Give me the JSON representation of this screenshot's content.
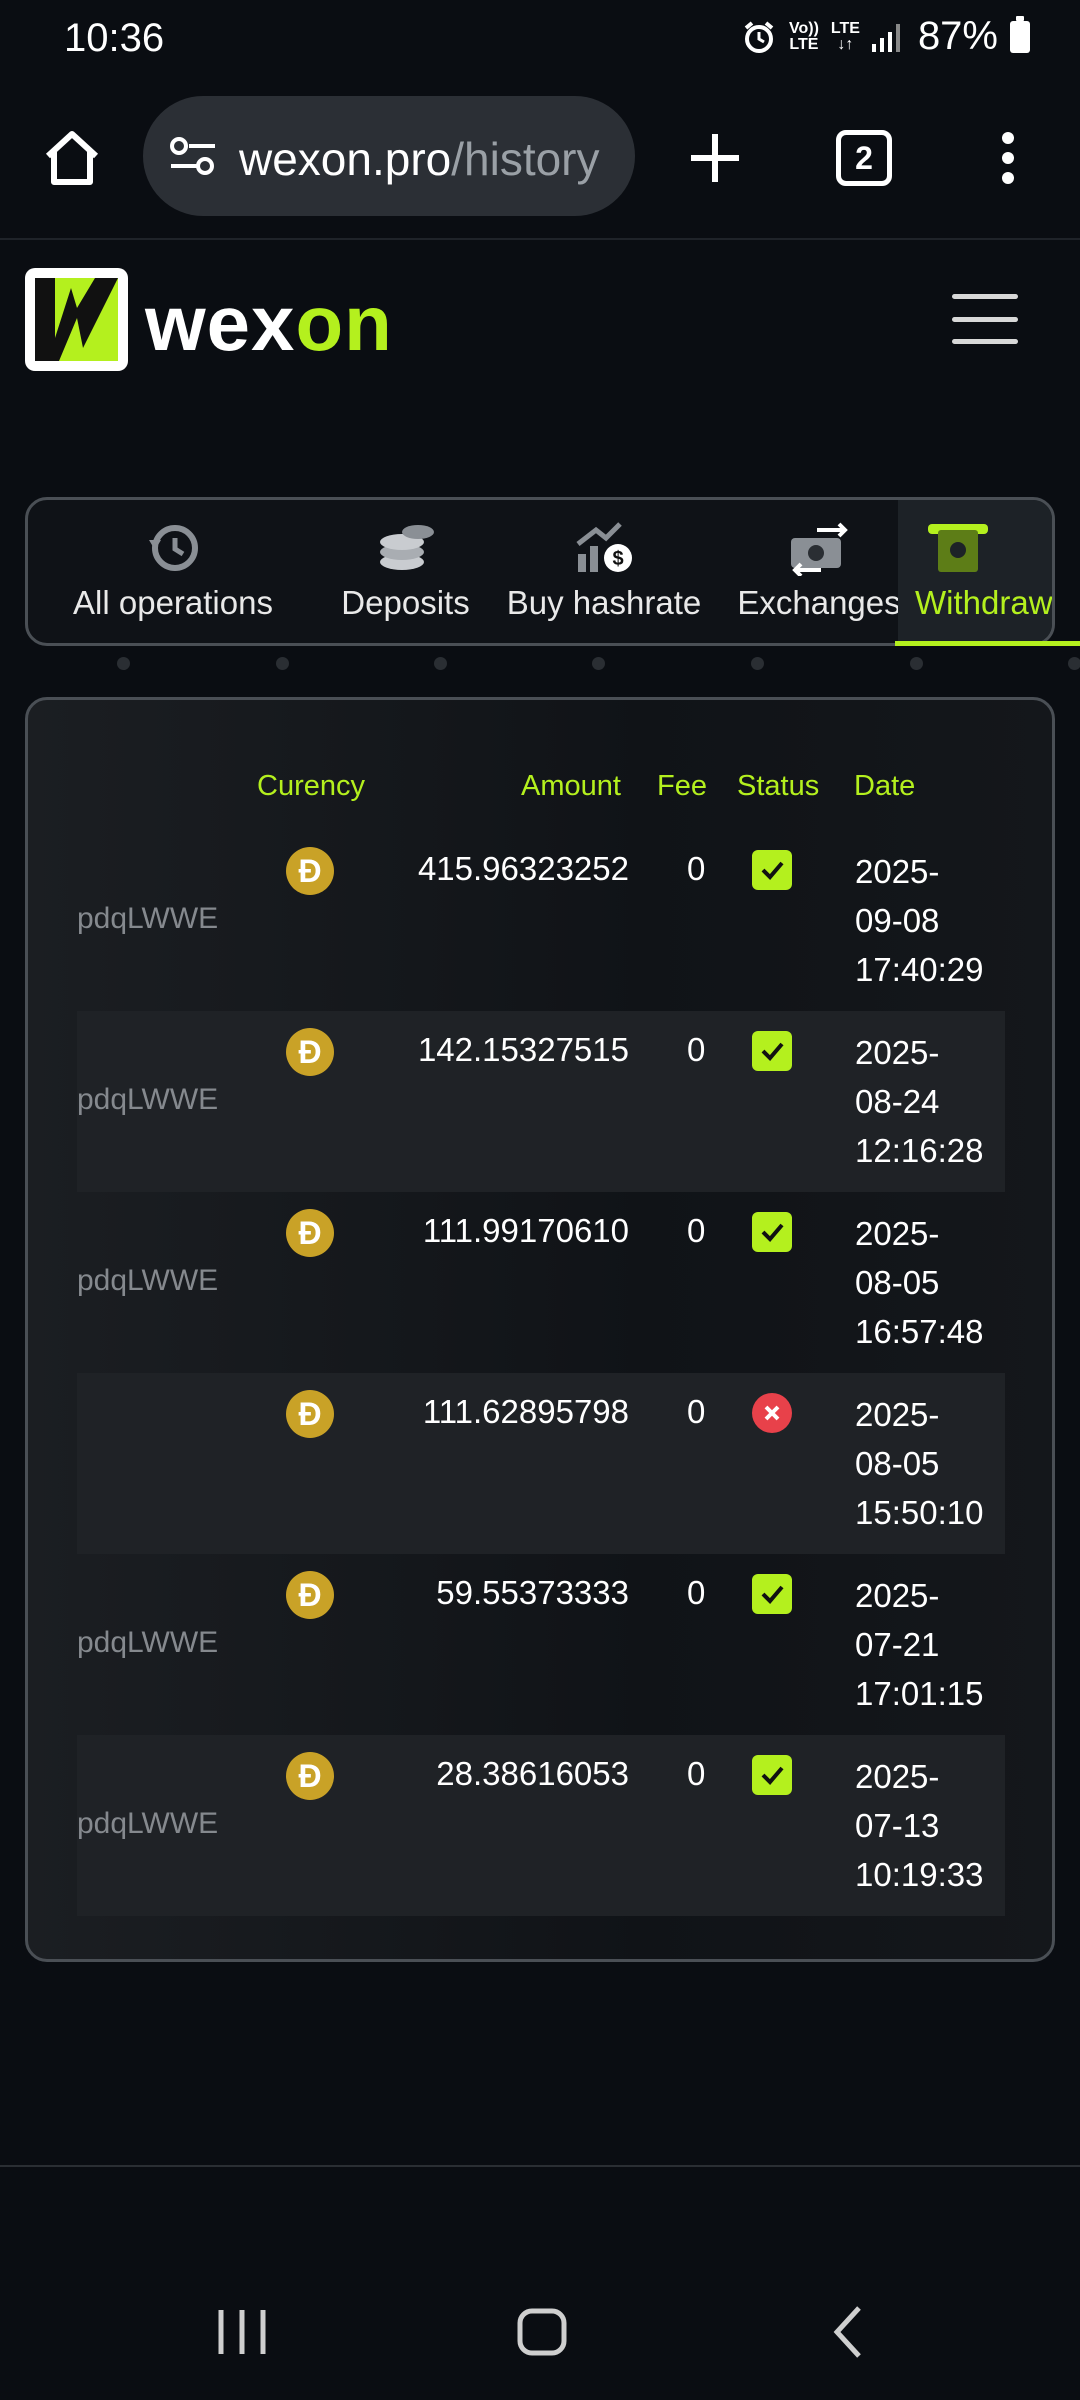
{
  "status_bar": {
    "time": "10:36",
    "volte_label_top": "Vo))",
    "volte_label_bottom": "LTE",
    "lte_label": "LTE",
    "battery": "87%"
  },
  "browser": {
    "url_domain": "wexon.pro",
    "url_path": "/history",
    "tab_count": "2"
  },
  "site": {
    "logo_part1": "wex",
    "logo_part2": "on",
    "accent_color": "#b4f01e"
  },
  "tabs": [
    {
      "label": "All operations",
      "icon": "history-icon"
    },
    {
      "label": "Deposits",
      "icon": "coins-stack-icon"
    },
    {
      "label": "Buy hashrate",
      "icon": "growth-chart-icon"
    },
    {
      "label": "Exchanges",
      "icon": "exchange-icon"
    },
    {
      "label": "Withdrawal",
      "icon": "withdraw-icon",
      "active": true
    }
  ],
  "table": {
    "headers": {
      "currency": "Curency",
      "amount": "Amount",
      "fee": "Fee",
      "status": "Status",
      "date": "Date"
    },
    "rows": [
      {
        "address": "pdqLWWE",
        "coin": "Ð",
        "amount": "415.96323252",
        "fee": "0",
        "status": "success",
        "date_l1": "2025-",
        "date_l2": "09-08",
        "date_l3": "17:40:29"
      },
      {
        "address": "pdqLWWE",
        "coin": "Ð",
        "amount": "142.15327515",
        "fee": "0",
        "status": "success",
        "date_l1": "2025-",
        "date_l2": "08-24",
        "date_l3": "12:16:28"
      },
      {
        "address": "pdqLWWE",
        "coin": "Ð",
        "amount": "111.99170610",
        "fee": "0",
        "status": "success",
        "date_l1": "2025-",
        "date_l2": "08-05",
        "date_l3": "16:57:48"
      },
      {
        "address": "",
        "coin": "Ð",
        "amount": "111.62895798",
        "fee": "0",
        "status": "failed",
        "date_l1": "2025-",
        "date_l2": "08-05",
        "date_l3": "15:50:10"
      },
      {
        "address": "pdqLWWE",
        "coin": "Ð",
        "amount": "59.55373333",
        "fee": "0",
        "status": "success",
        "date_l1": "2025-",
        "date_l2": "07-21",
        "date_l3": "17:01:15"
      },
      {
        "address": "pdqLWWE",
        "coin": "Ð",
        "amount": "28.38616053",
        "fee": "0",
        "status": "success",
        "date_l1": "2025-",
        "date_l2": "07-13",
        "date_l3": "10:19:33"
      }
    ]
  }
}
